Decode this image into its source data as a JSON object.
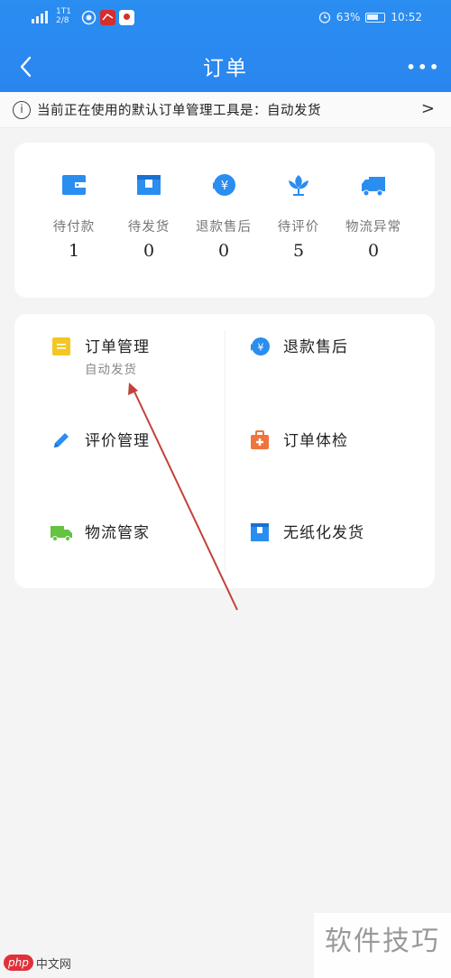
{
  "status_bar": {
    "carrier": "1T1\n2/8",
    "battery": "63%",
    "time": "10:52"
  },
  "nav": {
    "title": "订单",
    "more": "•••"
  },
  "notice": {
    "text": "当前正在使用的默认订单管理工具是：自动发货"
  },
  "stats": [
    {
      "label": "待付款",
      "value": "1",
      "icon": "wallet-icon"
    },
    {
      "label": "待发货",
      "value": "0",
      "icon": "package-icon"
    },
    {
      "label": "退款售后",
      "value": "0",
      "icon": "refund-icon"
    },
    {
      "label": "待评价",
      "value": "5",
      "icon": "flower-icon"
    },
    {
      "label": "物流异常",
      "value": "0",
      "icon": "truck-icon"
    }
  ],
  "tools": [
    {
      "name": "订单管理",
      "sub": "自动发货",
      "icon": "order-note-icon"
    },
    {
      "name": "退款售后",
      "icon": "refund-icon"
    },
    {
      "name": "评价管理",
      "icon": "pencil-icon"
    },
    {
      "name": "订单体检",
      "icon": "medical-kit-icon"
    },
    {
      "name": "物流管家",
      "icon": "truck-icon"
    },
    {
      "name": "无纸化发货",
      "icon": "box-icon"
    }
  ],
  "watermark": {
    "site": "中文网",
    "logo": "php",
    "cn": "软件技巧"
  },
  "colors": {
    "header": "#2a8df0",
    "icon_blue": "#2a8df0",
    "order_yellow": "#f3c623",
    "medical_orange": "#f0743d",
    "truck_green": "#64c340"
  }
}
